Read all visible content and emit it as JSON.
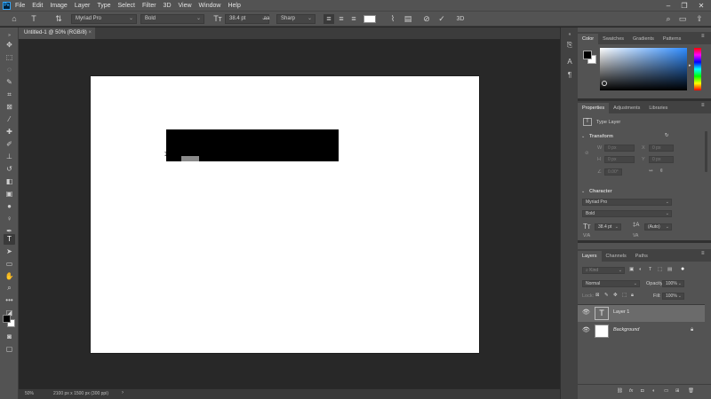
{
  "menubar": {
    "logo": "Ps",
    "items": [
      "File",
      "Edit",
      "Image",
      "Layer",
      "Type",
      "Select",
      "Filter",
      "3D",
      "View",
      "Window",
      "Help"
    ]
  },
  "options": {
    "font_family": "Myriad Pro",
    "font_style": "Bold",
    "font_size": "38.4 pt",
    "anti_alias": "Sharp",
    "text_color": "#ffffff"
  },
  "document": {
    "tab_title": "Untitled-1 @ 50% (RGB/8)",
    "close_glyph": "×",
    "zoom": "50%",
    "doc_info": "2100 px x 1500 px (300 ppi)"
  },
  "color_panel": {
    "tabs": [
      "Color",
      "Swatches",
      "Gradients",
      "Patterns"
    ],
    "foreground": "#000000",
    "background": "#ffffff"
  },
  "properties_panel": {
    "tabs": [
      "Properties",
      "Adjustments",
      "Libraries"
    ],
    "layer_type": "Type Layer",
    "transform_label": "Transform",
    "transform_fields": {
      "w_label": "W",
      "w": "0 px",
      "x_label": "X",
      "x": "0 px",
      "h_label": "H",
      "h": "0 px",
      "y_label": "Y",
      "y": "0 px",
      "angle": "0.00°"
    },
    "character_label": "Character",
    "font_family": "Myriad Pro",
    "font_style": "Bold",
    "font_size": "38.4 pt",
    "leading": "(Auto)"
  },
  "layers_panel": {
    "tabs": [
      "Layers",
      "Channels",
      "Paths"
    ],
    "search_placeholder": "Kind",
    "blend_mode": "Normal",
    "opacity_label": "Opacity:",
    "opacity": "100%",
    "lock_label": "Lock:",
    "fill_label": "Fill:",
    "fill": "100%",
    "layers": [
      {
        "name": "Layer 1",
        "thumb_glyph": "T"
      },
      {
        "name": "Background"
      }
    ]
  }
}
